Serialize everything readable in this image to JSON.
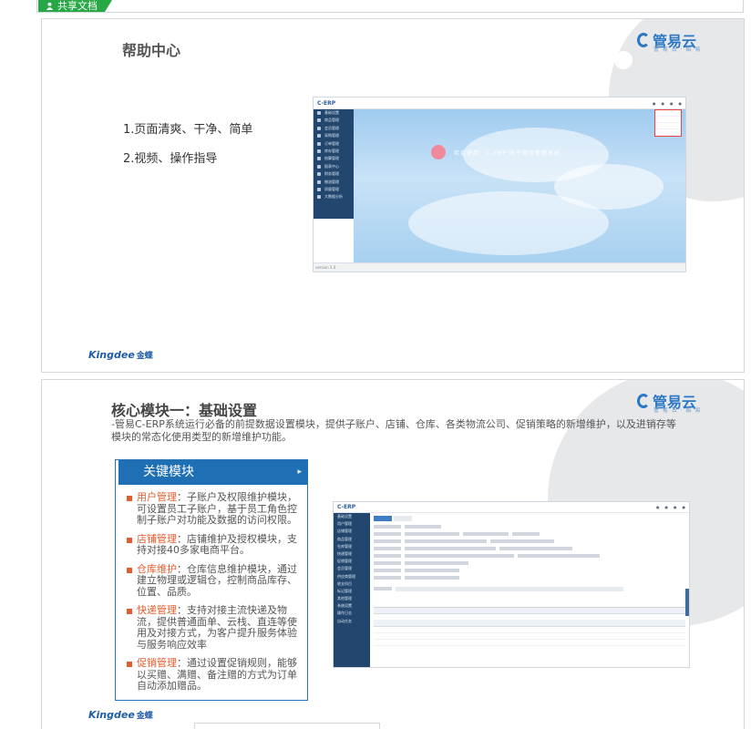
{
  "share_tag": {
    "label": "共享文档",
    "icon": "user-icon",
    "color": "#27a844"
  },
  "brand": {
    "logo_text": "管易云",
    "logo_sub": "管 易 云 · 酷 易",
    "kingdee": "Kingdee",
    "kingdee_cn": "金蝶"
  },
  "slide1": {
    "title": "帮助中心",
    "points": [
      "1.页面清爽、干净、简单",
      "2.视频、操作指导"
    ],
    "shot": {
      "app_name": "C-ERP",
      "welcome": "欢迎使用：C-ERP 电子商务管理系统",
      "menu": [
        "基础设置",
        "商品管理",
        "会员管理",
        "采购管理",
        "订单管理",
        "库存管理",
        "结算管理",
        "报表中心",
        "财务管理",
        "物流管理",
        "质量管理",
        "大数据分析"
      ],
      "footer": "version 3.0"
    }
  },
  "slide2": {
    "title": "核心模块一：基础设置",
    "description": "-管易C-ERP系统运行必备的前提数据设置模块，提供子账户、店铺、仓库、各类物流公司、促销策略的新增维护，以及进销存等模块的常态化使用类型的新增维护功能。",
    "key_title": "关键模块",
    "items": [
      {
        "name": "用户管理",
        "text": "：子账户及权限维护模块，可设置员工子账户，基于员工角色控制子账户对功能及数据的访问权限。"
      },
      {
        "name": "店铺管理",
        "text": "：店铺维护及授权模块，支持对接40多家电商平台。"
      },
      {
        "name": "仓库维护",
        "text": "：仓库信息维护模块，通过建立物理或逻辑仓，控制商品库存、位置、品质。"
      },
      {
        "name": "快递管理",
        "text": "：支持对接主流快递及物流，提供普通面单、云栈、直连等使用及对接方式，为客户提升服务体验与服务响应效率"
      },
      {
        "name": "促销管理",
        "text": "：通过设置促销规则，能够以买赠、满赠、备注赠的方式为订单自动添加赠品。"
      }
    ],
    "shot": {
      "app_name": "C-ERP",
      "menu": [
        "基础设置",
        "用户管理",
        "店铺管理",
        "商品管理",
        "仓库管理",
        "快递管理",
        "促销管理",
        "会员管理",
        "供应商管理",
        "收支科目",
        "标记管理",
        "其他管理",
        "系统设置",
        "操作日志",
        "自动任务"
      ]
    }
  }
}
